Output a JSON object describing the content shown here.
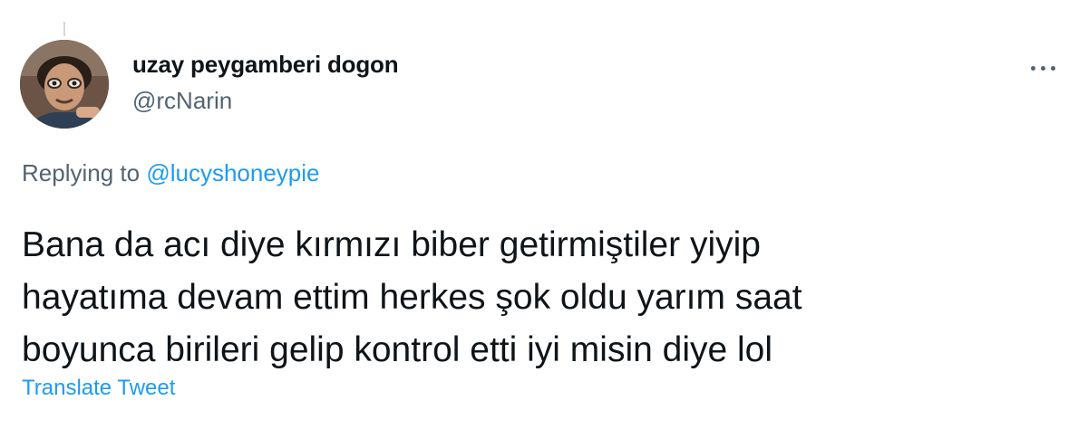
{
  "tweet": {
    "author": {
      "display_name": "uzay peygamberi dogon",
      "handle": "@rcNarin",
      "avatar_icon": "profile-photo"
    },
    "more_icon": "more-horizontal-icon",
    "replying_to": {
      "prefix": "Replying to",
      "mention": "@lucyshoneypie"
    },
    "text_lines": [
      "Bana da acı diye kırmızı biber getirmiştiler yiyip",
      "hayatıma devam ettim herkes şok oldu yarım saat",
      "boyunca birileri gelip kontrol etti iyi misin diye lol"
    ],
    "translate_label": "Translate Tweet"
  },
  "colors": {
    "text_primary": "#0f1419",
    "text_secondary": "#536471",
    "accent": "#1d9bf0"
  }
}
